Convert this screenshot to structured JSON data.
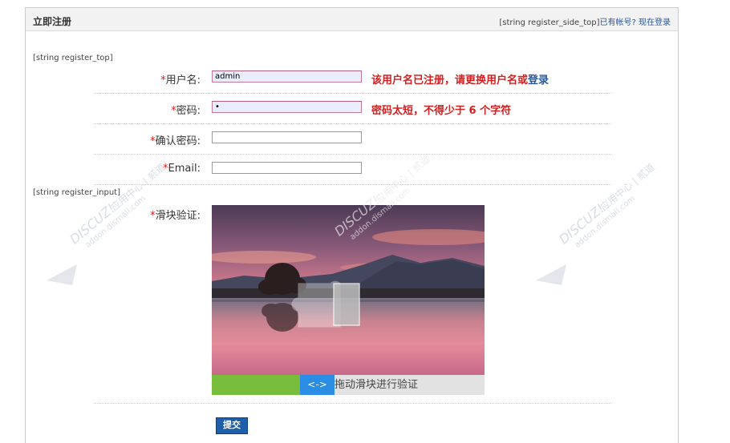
{
  "header": {
    "title": "立即注册",
    "side_top": "[string register_side_top]",
    "has_account": "已有帐号?",
    "login_now": "现在登录"
  },
  "register_top": "[string register_top]",
  "register_input": "[string register_input]",
  "fields": {
    "required_mark": "*",
    "username": {
      "label": "用户名:",
      "value": "admin",
      "error": "该用户名已注册，请更换用户名或",
      "error_link": "登录"
    },
    "password": {
      "label": "密码:",
      "value": "•",
      "error": "密码太短，不得少于 6 个字符"
    },
    "confirm_password": {
      "label": "确认密码:",
      "value": ""
    },
    "email": {
      "label": "Email:",
      "value": ""
    }
  },
  "captcha": {
    "label": "滑块验证:",
    "handle_text": "<->",
    "hint": "拖动滑块进行验证"
  },
  "submit_label": "提交",
  "watermark": {
    "brand": "DISCUZ!",
    "text": "应用中心 | 贰道",
    "url": "addon.dismall.com"
  },
  "colors": {
    "error_red": "#d42020",
    "link_blue": "#2b5797",
    "slider_green": "#78bd3c",
    "slider_blue": "#2b8de3",
    "button_blue": "#1f5ea8"
  }
}
